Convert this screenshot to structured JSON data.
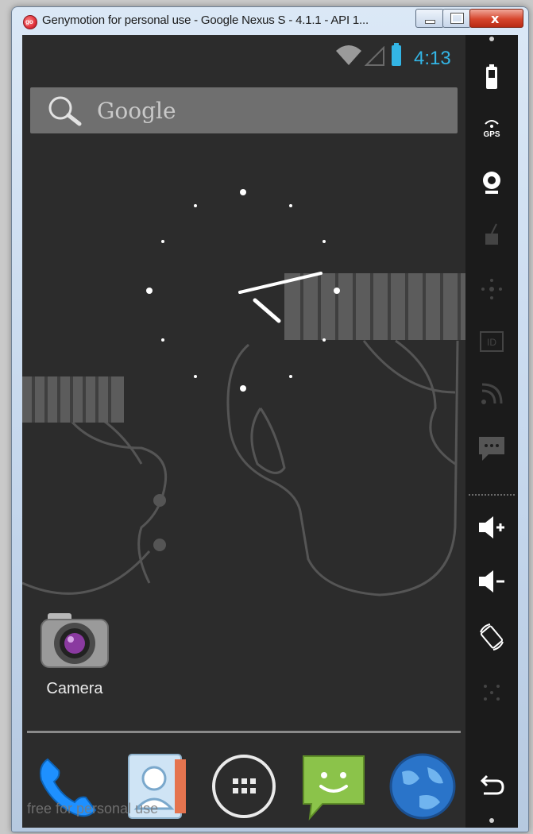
{
  "window": {
    "title": "Genymotion for personal use - Google Nexus S - 4.1.1 - API 1...",
    "app_icon": "genymotion-logo-icon",
    "app_icon_text": "go",
    "controls": [
      "minimize-icon",
      "maximize-icon",
      "close-icon"
    ],
    "close_glyph": "x"
  },
  "status_bar": {
    "time": "4:13",
    "icons": [
      "wifi-icon",
      "signal-icon",
      "battery-icon"
    ],
    "accent_color": "#33b5e5"
  },
  "search": {
    "label": "Google",
    "icon": "search-icon"
  },
  "home": {
    "widgets": [
      "analog-clock"
    ],
    "apps": [
      {
        "label": "Camera",
        "icon": "camera-icon"
      }
    ],
    "dock": [
      "phone-icon",
      "contacts-icon",
      "all-apps-icon",
      "messaging-icon",
      "browser-icon"
    ]
  },
  "watermark": "free for personal use",
  "sidebar": {
    "tools": [
      "battery-tool-icon",
      "gps-tool-icon",
      "webcam-tool-icon",
      "remote-control-icon",
      "dpad-icon",
      "device-id-icon",
      "network-icon",
      "sms-icon",
      "volume-up-icon",
      "volume-down-icon",
      "rotate-icon",
      "dpad-center-icon",
      "back-icon"
    ],
    "gps_text": "GPS",
    "id_text": "ID"
  }
}
